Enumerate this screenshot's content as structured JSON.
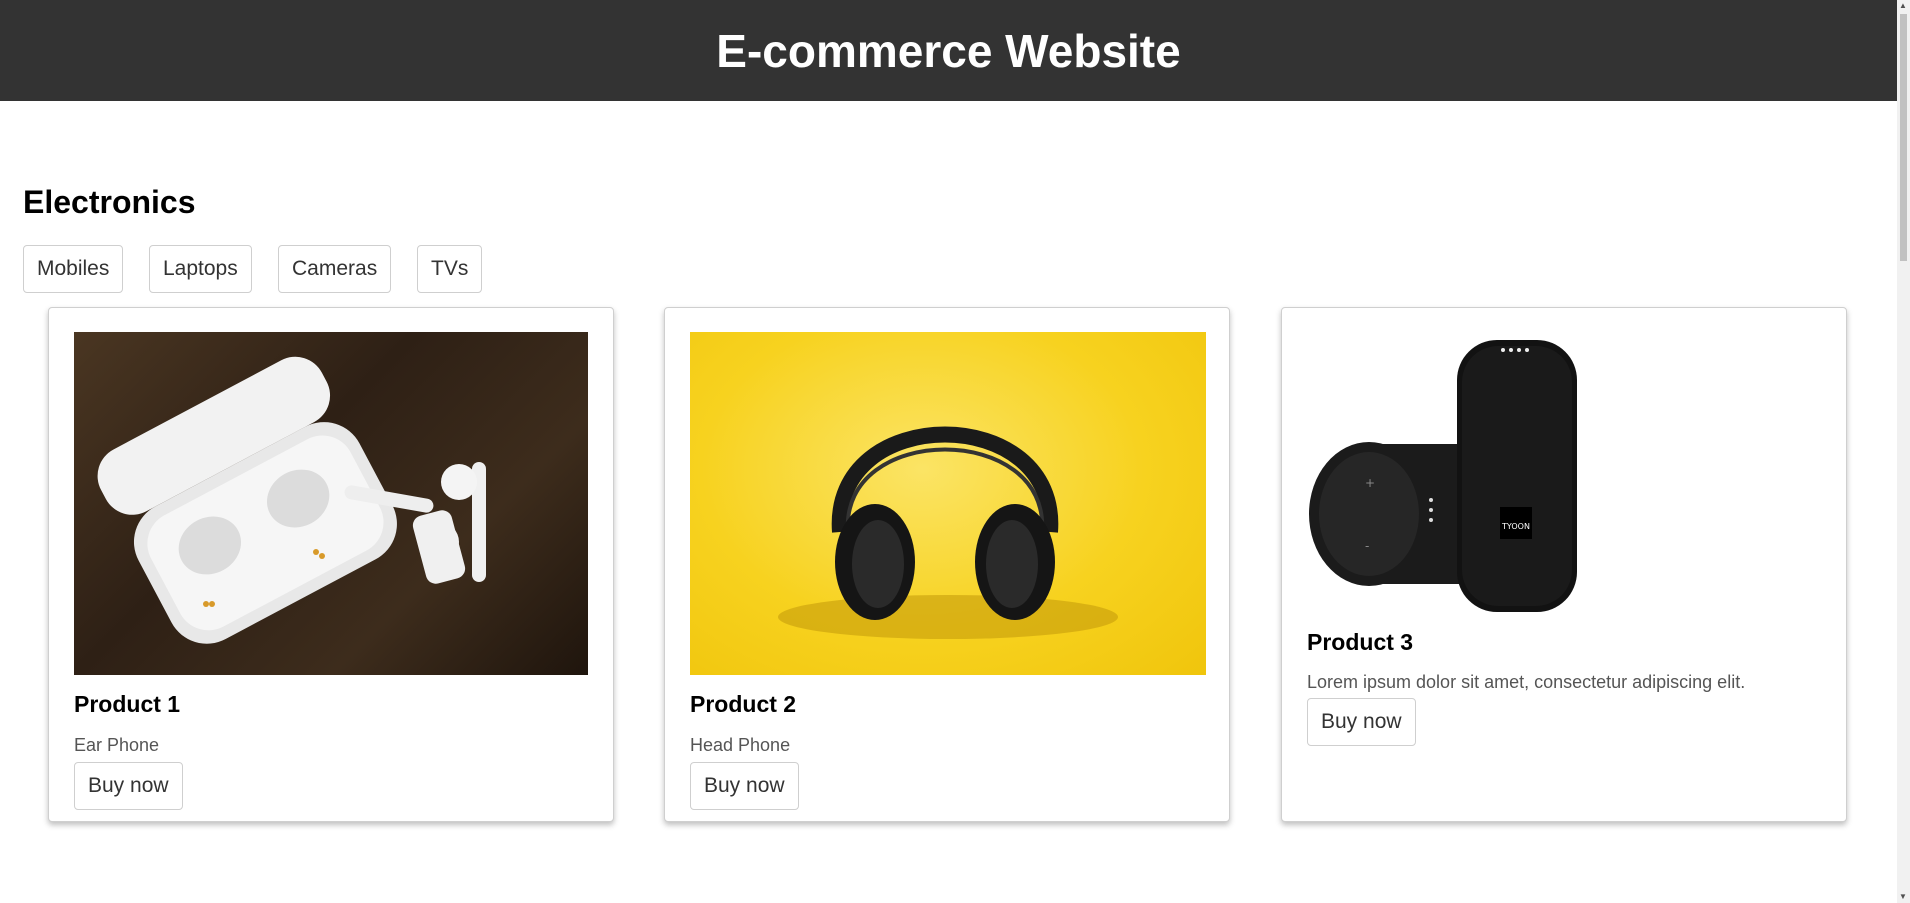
{
  "header": {
    "title": "E-commerce Website"
  },
  "category": {
    "title": "Electronics",
    "buttons": [
      "Mobiles",
      "Laptops",
      "Cameras",
      "TVs"
    ]
  },
  "products": [
    {
      "title": "Product 1",
      "description": "Ear Phone",
      "button": "Buy now",
      "image": "earbuds-image"
    },
    {
      "title": "Product 2",
      "description": "Head Phone",
      "button": "Buy now",
      "image": "headphones-image"
    },
    {
      "title": "Product 3",
      "description": "Lorem ipsum dolor sit amet, consectetur adipiscing elit.",
      "button": "Buy now",
      "image": "speaker-image"
    }
  ],
  "colors": {
    "header_bg": "#333333",
    "headphone_bg": "#f7d21f",
    "wood_bg": "#3b2a1a"
  }
}
